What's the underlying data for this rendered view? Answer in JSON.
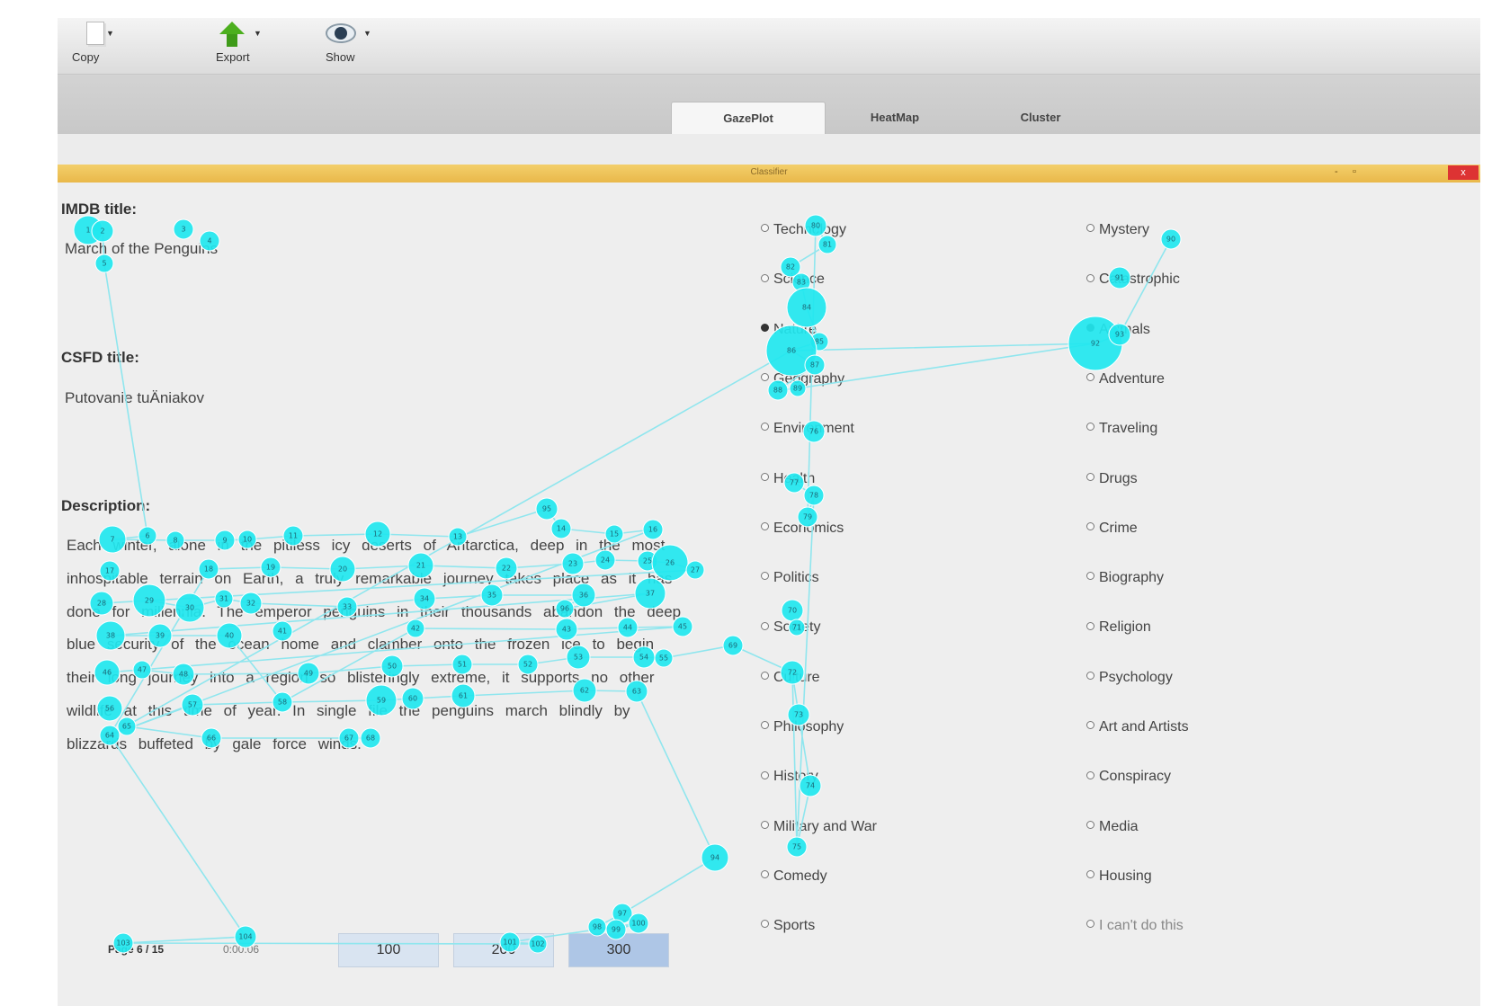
{
  "toolbar": {
    "copy_label": "Copy",
    "export_label": "Export",
    "show_label": "Show"
  },
  "tabs": [
    {
      "label": "GazePlot",
      "active": true
    },
    {
      "label": "HeatMap",
      "active": false
    },
    {
      "label": "Cluster",
      "active": false
    }
  ],
  "window": {
    "title": "Classifier",
    "close_label": "x",
    "minimize_label": "-"
  },
  "imdb": {
    "heading": "IMDB title:",
    "value": "March of the Penguins"
  },
  "csfd": {
    "heading": "CSFD title:",
    "value": "Putovanie tuÄniakov"
  },
  "description": {
    "heading": "Description:",
    "lines": [
      "Each winter, alone in the pitiless icy deserts of Antarctica, deep in the most",
      "inhospitable terrain on Earth, a truly remarkable journey takes place as it has",
      "done for millennia. The emperor penguins in their thousands abandon the deep",
      "blue security of the ocean home and clamber onto the frozen ice to begin",
      "their long journey into a region so blisteringly extreme, it supports no other",
      "wildlife at this time of year. In single file the penguins march blindly by",
      "blizzards buffeted by gale force winds."
    ]
  },
  "categories_left": [
    "Technology",
    "Science",
    "Nature",
    "Geography",
    "Environment",
    "Health",
    "Economics",
    "Politics",
    "Society",
    "Culture",
    "Philosophy",
    "History",
    "Military and War",
    "Comedy",
    "Sports"
  ],
  "categories_right": [
    "Mystery",
    "Catastrophic",
    "Animals",
    "Adventure",
    "Traveling",
    "Drugs",
    "Crime",
    "Biography",
    "Religion",
    "Psychology",
    "Art and Artists",
    "Conspiracy",
    "Media",
    "Housing",
    "I can't do this"
  ],
  "selected": {
    "left": "Nature",
    "right": "Animals"
  },
  "bottom": {
    "page_label": "Page 6 / 15",
    "time_label": "0:00:06",
    "buttons": [
      "100",
      "200",
      "300"
    ]
  },
  "gaze": {
    "color": "#21e7ef",
    "line_color": "#8fe6ee",
    "points": [
      [
        98,
        256,
        1,
        16
      ],
      [
        114,
        257,
        2,
        12
      ],
      [
        204,
        255,
        3,
        11
      ],
      [
        233,
        268,
        4,
        11
      ],
      [
        116,
        293,
        5,
        10
      ],
      [
        164,
        596,
        6,
        10
      ],
      [
        125,
        600,
        7,
        15
      ],
      [
        195,
        601,
        8,
        10
      ],
      [
        250,
        601,
        9,
        11
      ],
      [
        275,
        600,
        10,
        10
      ],
      [
        326,
        596,
        11,
        11
      ],
      [
        420,
        594,
        12,
        14
      ],
      [
        509,
        597,
        13,
        10
      ],
      [
        624,
        588,
        14,
        11
      ],
      [
        683,
        594,
        15,
        10
      ],
      [
        726,
        589,
        16,
        11
      ],
      [
        122,
        635,
        17,
        11
      ],
      [
        232,
        633,
        18,
        11
      ],
      [
        301,
        631,
        19,
        11
      ],
      [
        381,
        633,
        20,
        14
      ],
      [
        468,
        629,
        21,
        14
      ],
      [
        563,
        632,
        22,
        12
      ],
      [
        637,
        627,
        23,
        12
      ],
      [
        673,
        623,
        24,
        11
      ],
      [
        720,
        624,
        25,
        11
      ],
      [
        745,
        626,
        26,
        20
      ],
      [
        773,
        634,
        27,
        10
      ],
      [
        113,
        671,
        28,
        13
      ],
      [
        166,
        668,
        29,
        18
      ],
      [
        211,
        676,
        30,
        16
      ],
      [
        249,
        666,
        31,
        10
      ],
      [
        279,
        671,
        32,
        12
      ],
      [
        386,
        675,
        33,
        11
      ],
      [
        472,
        666,
        34,
        12
      ],
      [
        547,
        662,
        35,
        12
      ],
      [
        649,
        662,
        36,
        13
      ],
      [
        723,
        660,
        37,
        17
      ],
      [
        123,
        707,
        38,
        16
      ],
      [
        178,
        707,
        39,
        13
      ],
      [
        255,
        707,
        40,
        14
      ],
      [
        314,
        702,
        41,
        11
      ],
      [
        462,
        699,
        42,
        10
      ],
      [
        630,
        700,
        43,
        12
      ],
      [
        698,
        698,
        44,
        11
      ],
      [
        759,
        697,
        45,
        11
      ],
      [
        119,
        748,
        46,
        14
      ],
      [
        158,
        745,
        47,
        10
      ],
      [
        204,
        750,
        48,
        12
      ],
      [
        343,
        749,
        49,
        12
      ],
      [
        436,
        741,
        50,
        12
      ],
      [
        514,
        739,
        51,
        11
      ],
      [
        587,
        739,
        52,
        11
      ],
      [
        643,
        731,
        53,
        13
      ],
      [
        716,
        731,
        54,
        12
      ],
      [
        738,
        732,
        55,
        10
      ],
      [
        122,
        788,
        56,
        14
      ],
      [
        214,
        784,
        57,
        12
      ],
      [
        314,
        781,
        58,
        11
      ],
      [
        424,
        779,
        59,
        17
      ],
      [
        459,
        777,
        60,
        12
      ],
      [
        515,
        774,
        61,
        13
      ],
      [
        650,
        768,
        62,
        13
      ],
      [
        708,
        769,
        63,
        12
      ],
      [
        122,
        818,
        64,
        11
      ],
      [
        141,
        808,
        65,
        10
      ],
      [
        235,
        821,
        66,
        11
      ],
      [
        388,
        821,
        67,
        11
      ],
      [
        412,
        821,
        68,
        11
      ],
      [
        815,
        718,
        69,
        11
      ],
      [
        881,
        679,
        70,
        12
      ],
      [
        886,
        698,
        71,
        9
      ],
      [
        881,
        748,
        72,
        13
      ],
      [
        888,
        795,
        73,
        12
      ],
      [
        901,
        874,
        74,
        12
      ],
      [
        886,
        942,
        75,
        11
      ],
      [
        905,
        480,
        76,
        12
      ],
      [
        883,
        537,
        77,
        11
      ],
      [
        905,
        551,
        78,
        11
      ],
      [
        898,
        575,
        79,
        11
      ],
      [
        907,
        251,
        80,
        12
      ],
      [
        920,
        272,
        81,
        10
      ],
      [
        879,
        297,
        82,
        11
      ],
      [
        891,
        314,
        83,
        10
      ],
      [
        897,
        342,
        84,
        22
      ],
      [
        911,
        380,
        85,
        10
      ],
      [
        880,
        390,
        86,
        28
      ],
      [
        906,
        406,
        87,
        11
      ],
      [
        865,
        434,
        88,
        11
      ],
      [
        887,
        432,
        89,
        9
      ],
      [
        1302,
        266,
        90,
        11
      ],
      [
        1245,
        309,
        91,
        12
      ],
      [
        1218,
        382,
        92,
        30
      ],
      [
        1245,
        372,
        93,
        12
      ],
      [
        795,
        954,
        94,
        15
      ],
      [
        608,
        566,
        95,
        12
      ],
      [
        628,
        677,
        96,
        10
      ],
      [
        692,
        1016,
        97,
        11
      ],
      [
        664,
        1031,
        98,
        10
      ],
      [
        685,
        1034,
        99,
        11
      ],
      [
        710,
        1027,
        100,
        11
      ],
      [
        567,
        1048,
        101,
        11
      ],
      [
        598,
        1050,
        102,
        10
      ],
      [
        137,
        1049,
        103,
        11
      ],
      [
        273,
        1042,
        104,
        12
      ]
    ],
    "path": [
      98,
      114,
      116,
      164,
      125,
      195,
      250,
      275,
      326,
      420,
      509,
      608,
      624,
      683,
      726,
      122,
      232,
      301,
      381,
      468,
      563,
      637,
      673,
      720,
      745,
      773,
      113,
      166,
      211,
      249,
      279,
      386,
      472,
      547,
      649,
      628,
      723,
      123,
      178,
      255,
      314,
      462,
      630,
      698,
      759,
      119,
      158,
      204,
      343,
      436,
      514,
      587,
      643,
      716,
      738,
      815,
      881,
      886,
      881,
      888,
      901,
      886,
      905,
      883,
      905,
      898,
      907,
      920,
      879,
      891,
      897,
      911,
      880,
      906,
      865,
      887,
      1218,
      1245,
      1302,
      1245,
      1218,
      880,
      122,
      214,
      314,
      424,
      459,
      515,
      650,
      708,
      795,
      692,
      664,
      685,
      710,
      567,
      598,
      137,
      273,
      122,
      141,
      235,
      388,
      412
    ]
  }
}
